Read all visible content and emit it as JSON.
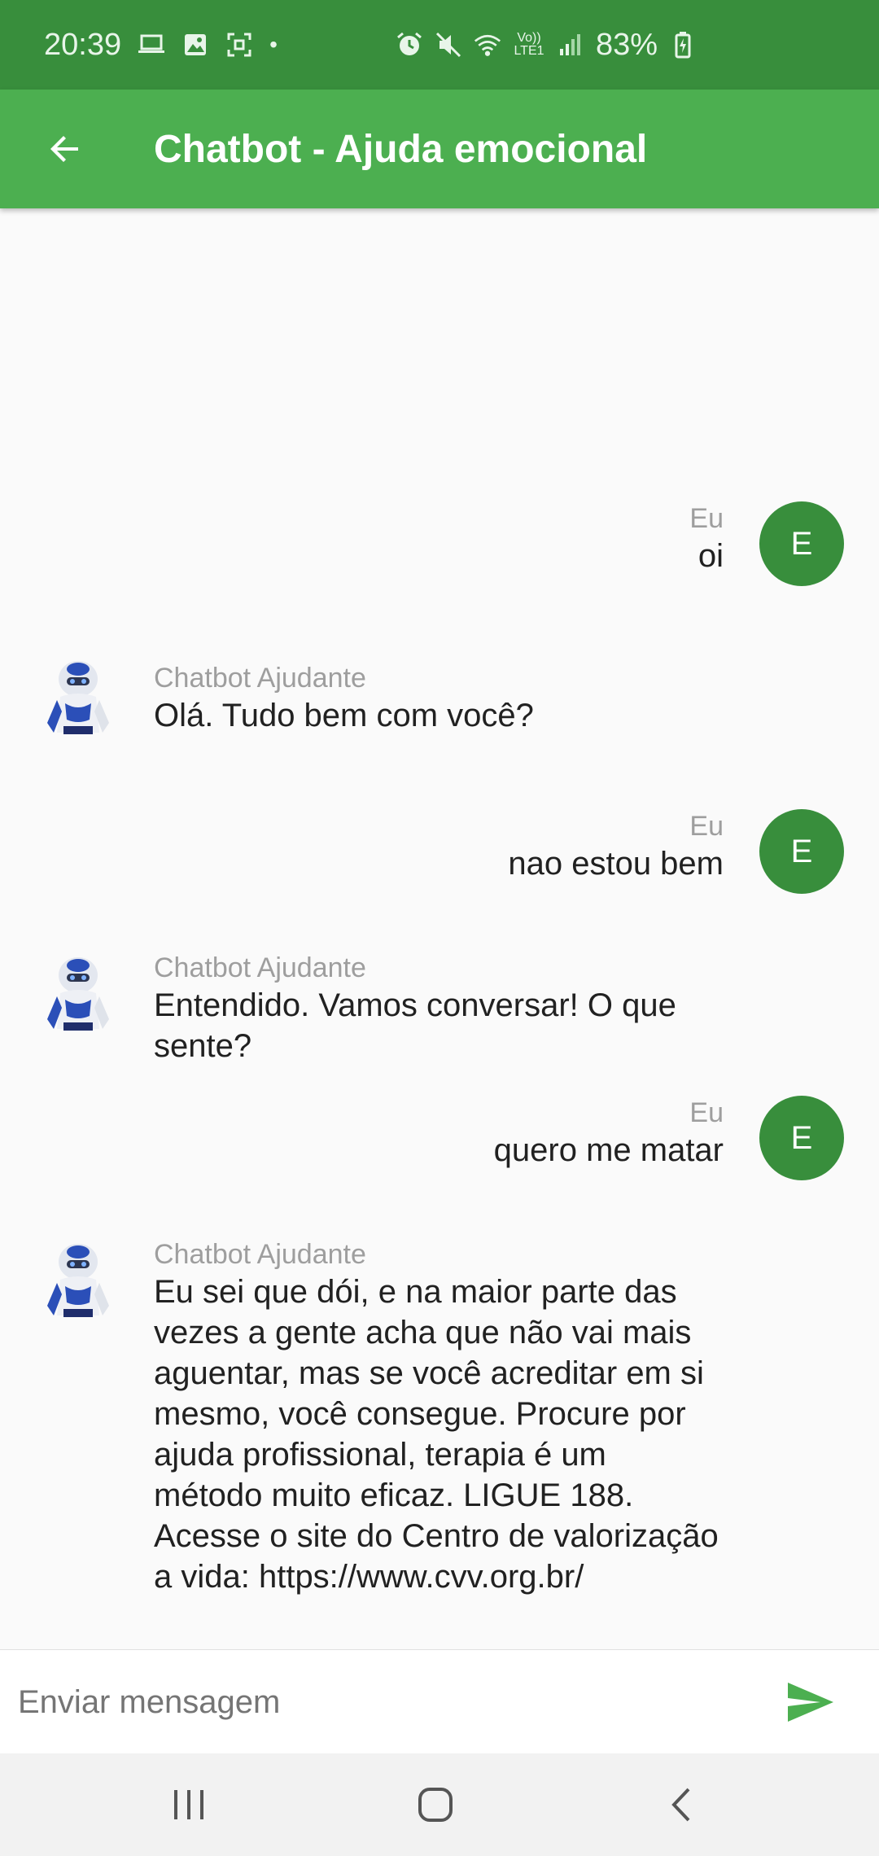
{
  "status_bar": {
    "time": "20:39",
    "dot": "•",
    "signal_label": "Vo)) LTE1",
    "battery": "83%",
    "icons": [
      "laptop-icon",
      "image-icon",
      "screenshot-icon",
      "alarm-icon",
      "mute-icon",
      "wifi-icon",
      "signal-icon",
      "battery-charging-icon"
    ]
  },
  "header": {
    "title": "Chatbot - Ajuda emocional",
    "back_icon": "arrow-back-icon",
    "background": "#4caf50"
  },
  "colors": {
    "status_bar": "#388e3c",
    "app_bar": "#4caf50",
    "user_avatar": "#388e3c",
    "send_icon": "#4caf50"
  },
  "messages": [
    {
      "type": "user",
      "sender": "Eu",
      "avatar_letter": "E",
      "text": "oi"
    },
    {
      "type": "bot",
      "sender": "Chatbot Ajudante",
      "avatar": "robot-avatar",
      "text": "Olá. Tudo bem com você?"
    },
    {
      "type": "user",
      "sender": "Eu",
      "avatar_letter": "E",
      "text": "nao estou bem"
    },
    {
      "type": "bot",
      "sender": "Chatbot Ajudante",
      "avatar": "robot-avatar",
      "text": "Entendido. Vamos conversar! O que sente?"
    },
    {
      "type": "user",
      "sender": "Eu",
      "avatar_letter": "E",
      "text": "quero me matar"
    },
    {
      "type": "bot",
      "sender": "Chatbot Ajudante",
      "avatar": "robot-avatar",
      "text": "Eu sei que dói, e na maior parte das vezes a gente acha que não vai mais aguentar, mas se você acreditar em si mesmo, você consegue. Procure por ajuda profissional, terapia é um método muito eficaz. LIGUE 188. Acesse o site do Centro de valorização a vida: https://www.cvv.org.br/"
    }
  ],
  "composer": {
    "placeholder": "Enviar mensagem",
    "send_icon": "send-icon"
  },
  "nav_bar": {
    "icons": [
      "recent-apps-icon",
      "home-icon",
      "back-icon"
    ]
  }
}
